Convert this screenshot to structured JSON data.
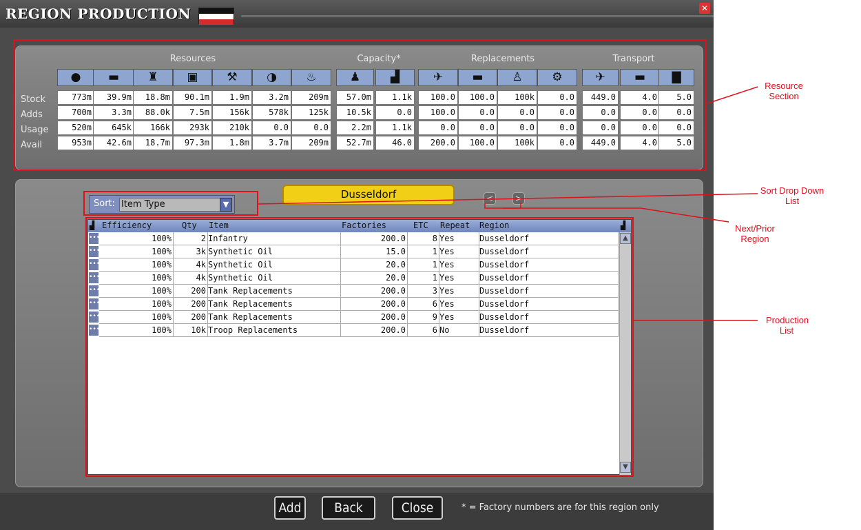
{
  "window": {
    "title": "REGION PRODUCTION",
    "flag_colors": [
      "#111111",
      "#ffffff",
      "#d62b2b"
    ]
  },
  "groups": {
    "resources": "Resources",
    "capacity": "Capacity*",
    "replacements": "Replacements",
    "transport": "Transport"
  },
  "row_labels": [
    "Stock",
    "Adds",
    "Usage",
    "Avail"
  ],
  "icons": [
    "coins-icon",
    "cattle-icon",
    "oil-derrick-icon",
    "coal-cart-icon",
    "hammer-pick-icon",
    "half-circle-icon",
    "oil-can-icon",
    "manpower-icon",
    "factory-icon",
    "aircraft-icon",
    "tank-icon",
    "soldier-icon",
    "gear-icon",
    "plane-transport-icon",
    "ship-icon",
    "train-icon"
  ],
  "icon_glyphs": [
    "●",
    "▬",
    "♜",
    "▣",
    "⚒",
    "◑",
    "♨",
    "♟",
    "▟",
    "✈",
    "▬",
    "♙",
    "⚙",
    "✈",
    "▬",
    "▇"
  ],
  "table": [
    [
      "773m",
      "39.9m",
      "18.8m",
      "90.1m",
      "1.9m",
      "3.2m",
      "209m",
      "57.0m",
      "1.1k",
      "100.0",
      "100.0",
      "100k",
      "0.0",
      "449.0",
      "4.0",
      "5.0"
    ],
    [
      "700m",
      "3.3m",
      "88.0k",
      "7.5m",
      "156k",
      "578k",
      "125k",
      "10.5k",
      "0.0",
      "100.0",
      "0.0",
      "0.0",
      "0.0",
      "0.0",
      "0.0",
      "0.0"
    ],
    [
      "520m",
      "645k",
      "166k",
      "293k",
      "210k",
      "0.0",
      "0.0",
      "2.2m",
      "1.1k",
      "0.0",
      "0.0",
      "0.0",
      "0.0",
      "0.0",
      "0.0",
      "0.0"
    ],
    [
      "953m",
      "42.6m",
      "18.7m",
      "97.3m",
      "1.8m",
      "3.7m",
      "209m",
      "52.7m",
      "46.0",
      "200.0",
      "100.0",
      "100k",
      "0.0",
      "449.0",
      "4.0",
      "5.0"
    ]
  ],
  "region": {
    "name": "Dusseldorf",
    "prev": "<",
    "next": ">"
  },
  "sort": {
    "label": "Sort:",
    "value": "Item Type"
  },
  "list": {
    "headers": [
      "Efficiency",
      "Qty",
      "Item",
      "Factories",
      "ETC",
      "Repeat",
      "Region"
    ],
    "rows": [
      [
        "100%",
        "2",
        "Infantry",
        "200.0",
        "8",
        "Yes",
        "Dusseldorf"
      ],
      [
        "100%",
        "3k",
        "Synthetic Oil",
        "15.0",
        "1",
        "Yes",
        "Dusseldorf"
      ],
      [
        "100%",
        "4k",
        "Synthetic Oil",
        "20.0",
        "1",
        "Yes",
        "Dusseldorf"
      ],
      [
        "100%",
        "4k",
        "Synthetic Oil",
        "20.0",
        "1",
        "Yes",
        "Dusseldorf"
      ],
      [
        "100%",
        "200",
        "Tank Replacements",
        "200.0",
        "3",
        "Yes",
        "Dusseldorf"
      ],
      [
        "100%",
        "200",
        "Tank Replacements",
        "200.0",
        "6",
        "Yes",
        "Dusseldorf"
      ],
      [
        "100%",
        "200",
        "Tank Replacements",
        "200.0",
        "9",
        "Yes",
        "Dusseldorf"
      ],
      [
        "100%",
        "10k",
        "Troop Replacements",
        "200.0",
        "6",
        "No",
        "Dusseldorf"
      ]
    ]
  },
  "buttons": {
    "add": "Add",
    "back": "Back",
    "close": "Close"
  },
  "footnote": "* = Factory numbers are for this region only",
  "annotations": {
    "resource": "Resource Section",
    "sort": "Sort Drop Down List",
    "next_prior": "Next/Prior Region",
    "production": "Production List"
  },
  "accent_color": "#e0101a"
}
